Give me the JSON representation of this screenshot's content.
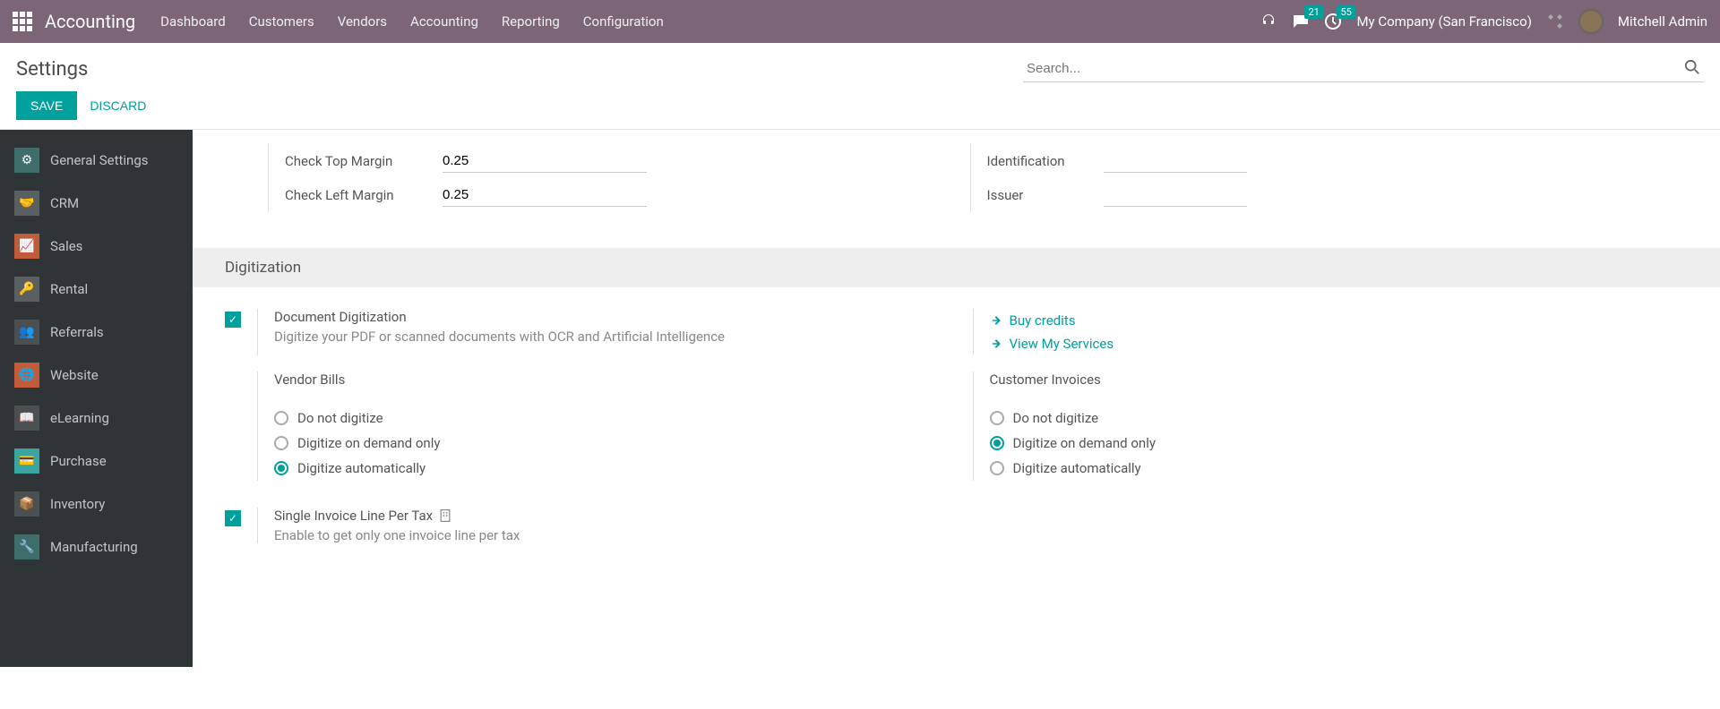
{
  "topbar": {
    "brand": "Accounting",
    "menu": [
      "Dashboard",
      "Customers",
      "Vendors",
      "Accounting",
      "Reporting",
      "Configuration"
    ],
    "msg_count": "21",
    "clock_count": "55",
    "company": "My Company (San Francisco)",
    "user": "Mitchell Admin"
  },
  "page": {
    "title": "Settings",
    "search_placeholder": "Search...",
    "save": "SAVE",
    "discard": "DISCARD"
  },
  "sidebar": {
    "items": [
      {
        "label": "General Settings"
      },
      {
        "label": "CRM"
      },
      {
        "label": "Sales"
      },
      {
        "label": "Rental"
      },
      {
        "label": "Referrals"
      },
      {
        "label": "Website"
      },
      {
        "label": "eLearning"
      },
      {
        "label": "Purchase"
      },
      {
        "label": "Inventory"
      },
      {
        "label": "Manufacturing"
      }
    ]
  },
  "checks": {
    "top_label": "Check Top Margin",
    "top_value": "0.25",
    "left_label": "Check Left Margin",
    "left_value": "0.25",
    "ident_label": "Identification",
    "issuer_label": "Issuer"
  },
  "digitization": {
    "section": "Digitization",
    "doc_title": "Document Digitization",
    "doc_desc": "Digitize your PDF or scanned documents with OCR and Artificial Intelligence",
    "buy_credits": "Buy credits",
    "view_services": "View My Services",
    "vendor_head": "Vendor Bills",
    "customer_head": "Customer Invoices",
    "opt1": "Do not digitize",
    "opt2": "Digitize on demand only",
    "opt3": "Digitize automatically",
    "single_line_title": "Single Invoice Line Per Tax",
    "single_line_desc": "Enable to get only one invoice line per tax"
  }
}
